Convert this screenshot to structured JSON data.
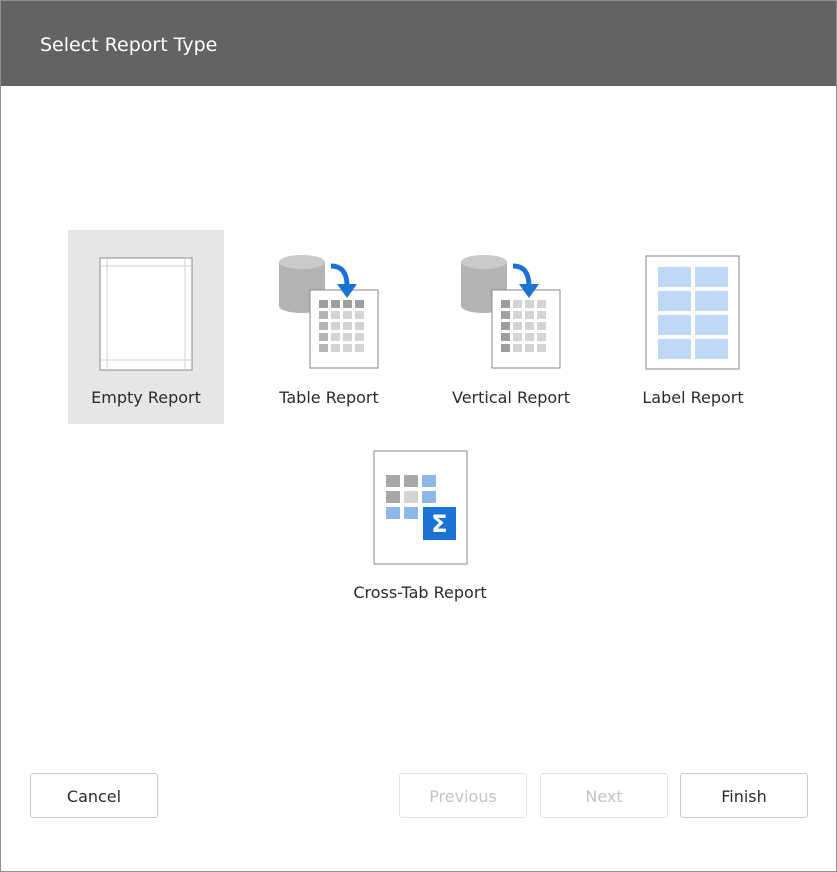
{
  "dialog": {
    "title": "Select Report Type"
  },
  "report_types": [
    {
      "label": "Empty Report",
      "icon": "empty-report-icon",
      "selected": true
    },
    {
      "label": "Table Report",
      "icon": "table-report-icon",
      "selected": false
    },
    {
      "label": "Vertical Report",
      "icon": "vertical-report-icon",
      "selected": false
    },
    {
      "label": "Label Report",
      "icon": "label-report-icon",
      "selected": false
    },
    {
      "label": "Cross-Tab Report",
      "icon": "cross-tab-report-icon",
      "selected": false
    }
  ],
  "footer": {
    "cancel_label": "Cancel",
    "previous_label": "Previous",
    "next_label": "Next",
    "finish_label": "Finish"
  },
  "colors": {
    "header_bg": "#636363",
    "selected_tile_bg": "#e6e6e6",
    "accent_blue": "#1a73d4",
    "light_blue": "#bed8f5"
  }
}
